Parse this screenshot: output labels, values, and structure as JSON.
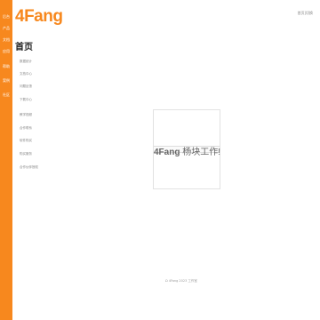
{
  "app": {
    "logo": "4Fang",
    "top_right": "首页|切换"
  },
  "leftbar": {
    "items": [
      "后台",
      "产品",
      "文档",
      "应用",
      "帮助",
      "案例",
      "社区"
    ]
  },
  "sidebar": {
    "title": "首页",
    "items": [
      "数据统计",
      "文档中心",
      "问题反馈",
      "下载中心",
      "教学视频",
      "合作联系",
      "软件购买",
      "购买服务",
      "合作伙伴授权"
    ]
  },
  "main": {
    "card_brand": "4Fang",
    "card_text": " 杨块工作!"
  },
  "footer": {
    "text": "Ω 4Fang 2023 工作室"
  },
  "colors": {
    "accent": "#f7881e"
  }
}
